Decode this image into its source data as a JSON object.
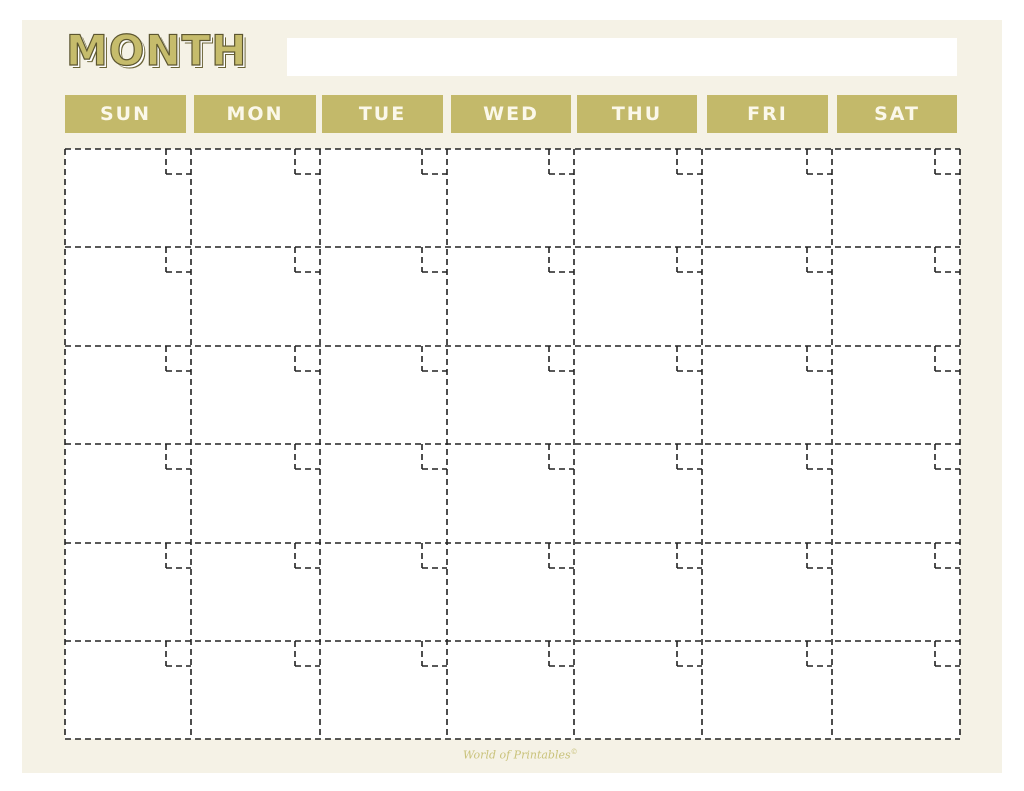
{
  "calendar": {
    "title": "MONTH",
    "month_field_value": "",
    "weekdays": [
      "SUN",
      "MON",
      "TUE",
      "WED",
      "THU",
      "FRI",
      "SAT"
    ],
    "weeks": 6,
    "days_per_week": 7,
    "cells": [
      [
        "",
        "",
        "",
        "",
        "",
        "",
        ""
      ],
      [
        "",
        "",
        "",
        "",
        "",
        "",
        ""
      ],
      [
        "",
        "",
        "",
        "",
        "",
        "",
        ""
      ],
      [
        "",
        "",
        "",
        "",
        "",
        "",
        ""
      ],
      [
        "",
        "",
        "",
        "",
        "",
        "",
        ""
      ],
      [
        "",
        "",
        "",
        "",
        "",
        "",
        ""
      ]
    ]
  },
  "footer": {
    "brand": "World of Printables",
    "mark": "©"
  },
  "colors": {
    "page_background": "#f5f2e6",
    "header_fill": "#c3b96a",
    "header_text": "#fbf8ea",
    "title_fill": "#c6bc6c",
    "grid_line": "#222222",
    "cell_background": "#ffffff"
  }
}
